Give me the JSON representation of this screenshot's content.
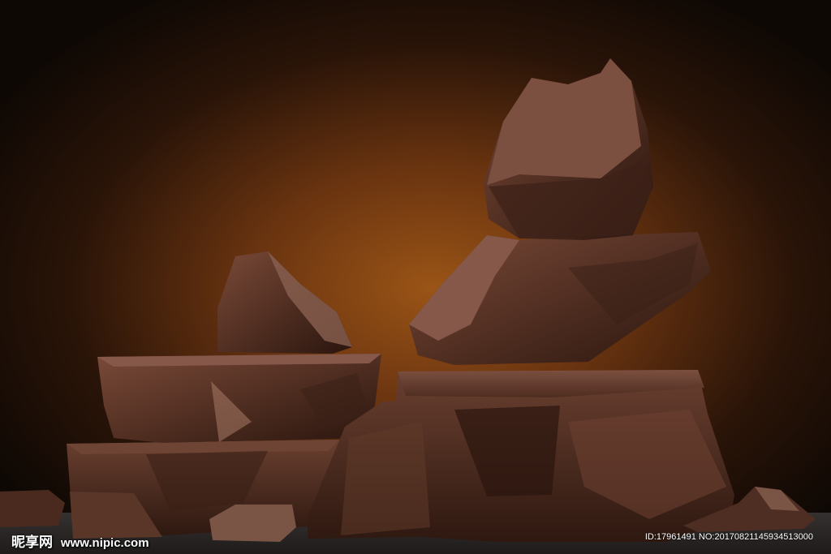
{
  "photo": {
    "subject": "",
    "colors": {
      "background_dark": "#120b06",
      "background_glow": "#8a4a12",
      "chocolate_dark": "#2e1810",
      "chocolate_mid": "#4a2a1e",
      "chocolate_light": "#6b4030",
      "surface": "#2a2624"
    }
  },
  "watermark": {
    "logo_text": "昵享网",
    "url": "www.nipic.com",
    "id_line": "ID:17961491 NO:20170821145934513000"
  }
}
